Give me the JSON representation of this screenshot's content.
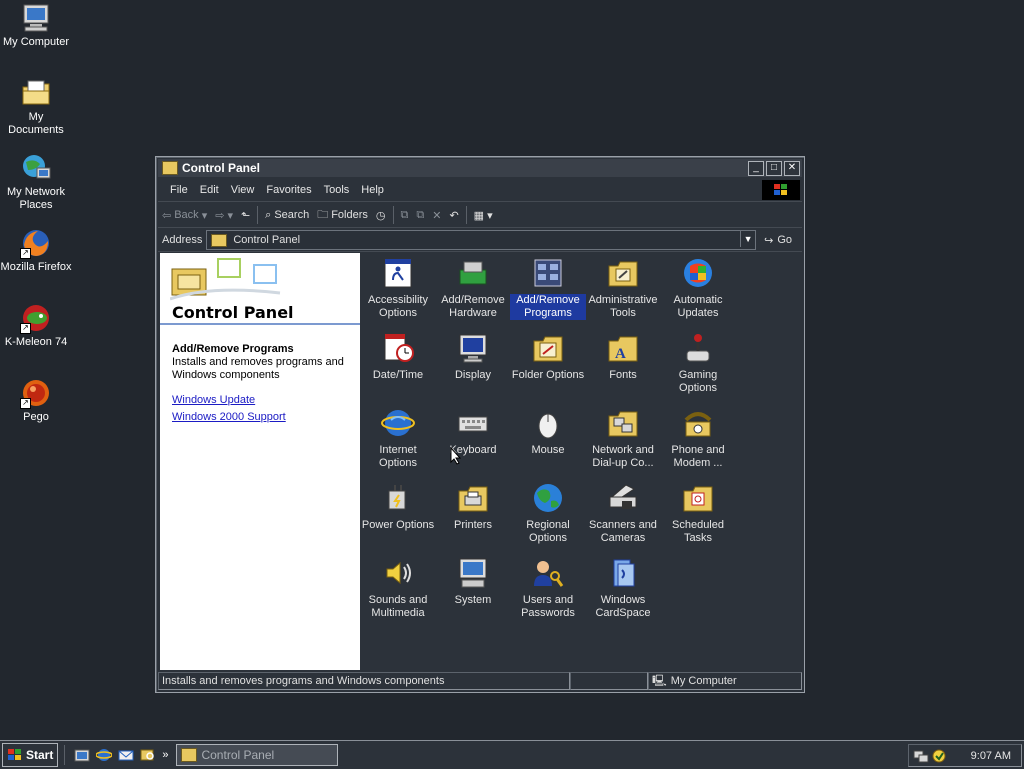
{
  "desktop": {
    "icons": [
      {
        "label": "My Computer",
        "icon": "my-computer-icon"
      },
      {
        "label": "My Documents",
        "icon": "my-documents-icon"
      },
      {
        "label": "My Network Places",
        "icon": "network-places-icon"
      },
      {
        "label": "Mozilla Firefox",
        "icon": "firefox-icon"
      },
      {
        "label": "K-Meleon 74",
        "icon": "kmeleon-icon"
      },
      {
        "label": "Pego",
        "icon": "pego-icon"
      }
    ]
  },
  "window": {
    "title": "Control Panel",
    "menu": [
      "File",
      "Edit",
      "View",
      "Favorites",
      "Tools",
      "Help"
    ],
    "toolbar": {
      "back": "Back",
      "search": "Search",
      "folders": "Folders"
    },
    "address": {
      "label": "Address",
      "value": "Control Panel",
      "go": "Go"
    },
    "left_pane": {
      "title": "Control Panel",
      "selected_title": "Add/Remove Programs",
      "selected_desc": "Installs and removes programs and Windows components",
      "links": [
        "Windows Update",
        "Windows 2000 Support"
      ]
    },
    "items": [
      {
        "label": "Accessibility Options",
        "icon": "accessibility-icon"
      },
      {
        "label": "Add/Remove Hardware",
        "icon": "hardware-icon"
      },
      {
        "label": "Add/Remove Programs",
        "icon": "programs-icon",
        "selected": true
      },
      {
        "label": "Administrative Tools",
        "icon": "admin-tools-icon"
      },
      {
        "label": "Automatic Updates",
        "icon": "updates-icon"
      },
      {
        "label": "Date/Time",
        "icon": "datetime-icon"
      },
      {
        "label": "Display",
        "icon": "display-icon"
      },
      {
        "label": "Folder Options",
        "icon": "folder-options-icon"
      },
      {
        "label": "Fonts",
        "icon": "fonts-icon"
      },
      {
        "label": "Gaming Options",
        "icon": "gaming-icon"
      },
      {
        "label": "Internet Options",
        "icon": "internet-icon"
      },
      {
        "label": "Keyboard",
        "icon": "keyboard-icon"
      },
      {
        "label": "Mouse",
        "icon": "mouse-icon"
      },
      {
        "label": "Network and Dial-up Co...",
        "icon": "network-icon"
      },
      {
        "label": "Phone and Modem ...",
        "icon": "phone-icon"
      },
      {
        "label": "Power Options",
        "icon": "power-icon"
      },
      {
        "label": "Printers",
        "icon": "printers-icon"
      },
      {
        "label": "Regional Options",
        "icon": "regional-icon"
      },
      {
        "label": "Scanners and Cameras",
        "icon": "scanner-icon"
      },
      {
        "label": "Scheduled Tasks",
        "icon": "tasks-icon"
      },
      {
        "label": "Sounds and Multimedia",
        "icon": "sounds-icon"
      },
      {
        "label": "System",
        "icon": "system-icon"
      },
      {
        "label": "Users and Passwords",
        "icon": "users-icon"
      },
      {
        "label": "Windows CardSpace",
        "icon": "cardspace-icon"
      }
    ],
    "status": {
      "text": "Installs and removes programs and Windows components",
      "zone": "My Computer"
    }
  },
  "taskbar": {
    "start": "Start",
    "task": "Control Panel",
    "clock": "9:07 AM"
  }
}
